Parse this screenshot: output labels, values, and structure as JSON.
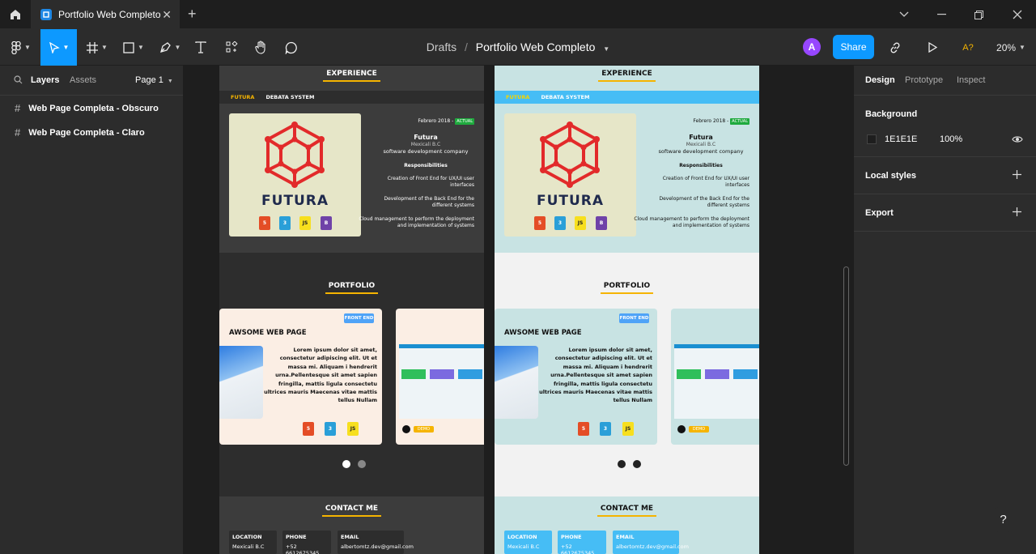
{
  "tab": {
    "title": "Portfolio Web Completo"
  },
  "toolbar": {
    "crumb_parent": "Drafts",
    "crumb_sep": "/",
    "file_name": "Portfolio Web Completo",
    "avatar": "A",
    "share": "Share",
    "font_warning": "A?",
    "zoom": "20%"
  },
  "left_panel": {
    "tabs": [
      "Layers",
      "Assets"
    ],
    "page": "Page 1",
    "layers": [
      "Web Page Completa - Obscuro",
      "Web Page Completa - Claro"
    ]
  },
  "right_panel": {
    "tabs": [
      "Design",
      "Prototype",
      "Inspect"
    ],
    "background_label": "Background",
    "background_hex": "1E1E1E",
    "background_opacity": "100%",
    "local_styles": "Local styles",
    "export": "Export"
  },
  "design": {
    "experience": "EXPERIENCE",
    "subnav": [
      "FUTURA",
      "DEBATA SYSTEM"
    ],
    "logo_text": "FUTURA",
    "badges": [
      "5",
      "3",
      "JS",
      "B"
    ],
    "date": "Febrero 2018 -",
    "actual": "ACTUAL",
    "company": "Futura",
    "location": "Mexicali B.C",
    "company_desc": "software development company",
    "responsibilities": "Responsibilities",
    "resp1": "Creation of Front End for UX/UI user interfaces",
    "resp2": "Development of the Back End for the different systems",
    "resp3": "Cloud management to perform the deployment and implementation of systems",
    "portfolio": "PORTFOLIO",
    "front_end": "FRONT END",
    "project_title": "AWSOME WEB PAGE",
    "lorem": "Lorem ipsum dolor sit amet, consectetur adipiscing elit. Ut et massa mi. Aliquam i hendrerit urna.Pellentesque sit amet sapien fringilla, mattis ligula consectetu ultrices mauris Maecenas vitae mattis tellus Nullam",
    "demo": "DEMO",
    "contact": "CONTACT ME",
    "contacts": [
      {
        "label": "LOCATION",
        "value": "Mexicali B.C"
      },
      {
        "label": "PHONE",
        "value": "+52 6612675345"
      },
      {
        "label": "EMAIL",
        "value": "albertomtz.dev@gmail.com"
      }
    ]
  },
  "help": "?",
  "colors": {
    "accent": "#0d99ff",
    "underline": "#f5b400",
    "dark_bg": "#3c3c3c",
    "light_bg": "#c8e3e3",
    "light_nav": "#46bdf5"
  }
}
